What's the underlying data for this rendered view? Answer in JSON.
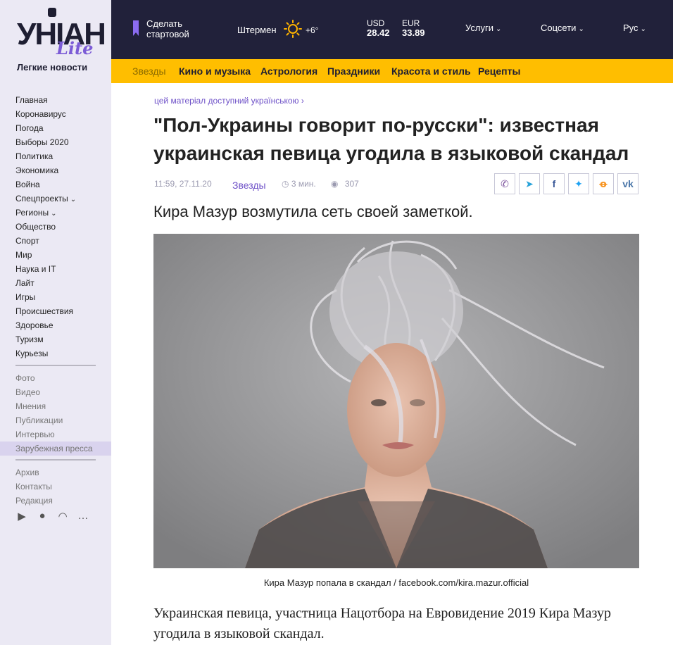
{
  "sidebar": {
    "logo_word": "УНІАН",
    "logo_lite": "Lite",
    "logo_sub": "Легкие новости",
    "nav_primary": [
      {
        "label": "Главная",
        "chevron": ""
      },
      {
        "label": "Коронавирус",
        "chevron": ""
      },
      {
        "label": "Погода",
        "chevron": ""
      },
      {
        "label": "Выборы 2020",
        "chevron": ""
      },
      {
        "label": "Политика",
        "chevron": ""
      },
      {
        "label": "Экономика",
        "chevron": ""
      },
      {
        "label": "Война",
        "chevron": ""
      },
      {
        "label": "Спецпроекты",
        "chevron": "⌄"
      },
      {
        "label": "Регионы",
        "chevron": "⌄"
      },
      {
        "label": "Общество",
        "chevron": ""
      },
      {
        "label": "Спорт",
        "chevron": ""
      },
      {
        "label": "Мир",
        "chevron": ""
      },
      {
        "label": "Наука и IT",
        "chevron": ""
      },
      {
        "label": "Лайт",
        "chevron": ""
      },
      {
        "label": "Игры",
        "chevron": ""
      },
      {
        "label": "Происшествия",
        "chevron": ""
      },
      {
        "label": "Здоровье",
        "chevron": ""
      },
      {
        "label": "Туризм",
        "chevron": ""
      },
      {
        "label": "Курьезы",
        "chevron": ""
      }
    ],
    "nav_secondary": [
      "Фото",
      "Видео",
      "Мнения",
      "Публикации",
      "Интервью",
      "Зарубежная пресса"
    ],
    "nav_tertiary": [
      "Архив",
      "Контакты",
      "Редакция"
    ],
    "app_icons": [
      "google-play-icon",
      "apple-icon",
      "rss-icon",
      "chat-icon"
    ]
  },
  "topbar": {
    "start_line1": "Сделать",
    "start_line2": "стартовой",
    "city": "Штермен",
    "weather_icon": "sun-icon",
    "temperature": "+6°",
    "usd_label": "USD",
    "usd_value": "28.42",
    "eur_label": "EUR",
    "eur_value": "33.89",
    "services": "Услуги",
    "social": "Соцсети",
    "language": "Рус"
  },
  "rubrics": [
    "Звезды",
    "Кино и музыка",
    "Астрология",
    "Праздники",
    "Красота и стиль",
    "Рецепты"
  ],
  "article": {
    "ua_link": "цей матеріал доступний українською",
    "title": "\"Пол-Украины говорит по-русски\": известная украинская певица угодила в языковой скандал",
    "date": "11:59, 27.11.20",
    "rubric": "Звезды",
    "read_time": "3 мин.",
    "views": "307",
    "share": [
      {
        "icon": "viber-icon",
        "glyph": "✆",
        "color": "#7b519d"
      },
      {
        "icon": "telegram-icon",
        "glyph": "➤",
        "color": "#2aa3d9"
      },
      {
        "icon": "facebook-icon",
        "glyph": "f",
        "color": "#3b5998"
      },
      {
        "icon": "twitter-icon",
        "glyph": "✦",
        "color": "#1da1f2"
      },
      {
        "icon": "odnoklassniki-icon",
        "glyph": "ꝋ",
        "color": "#f7931e"
      },
      {
        "icon": "vk-icon",
        "glyph": "vk",
        "color": "#4a76a8"
      }
    ],
    "lead": "Кира Мазур возмутила сеть своей заметкой.",
    "photo_caption": "Кира Мазур попала в скандал / facebook.com/kira.mazur.official",
    "body": "Украинская певица, участница Нацотбора на Евровидение 2019 Кира Мазур угодила в языковой скандал."
  },
  "colors": {
    "topbar_bg": "#21213a",
    "rubric_bar": "#ffbe00",
    "accent": "#6f52c8",
    "sidebar_bg": "#ebe9f4"
  }
}
